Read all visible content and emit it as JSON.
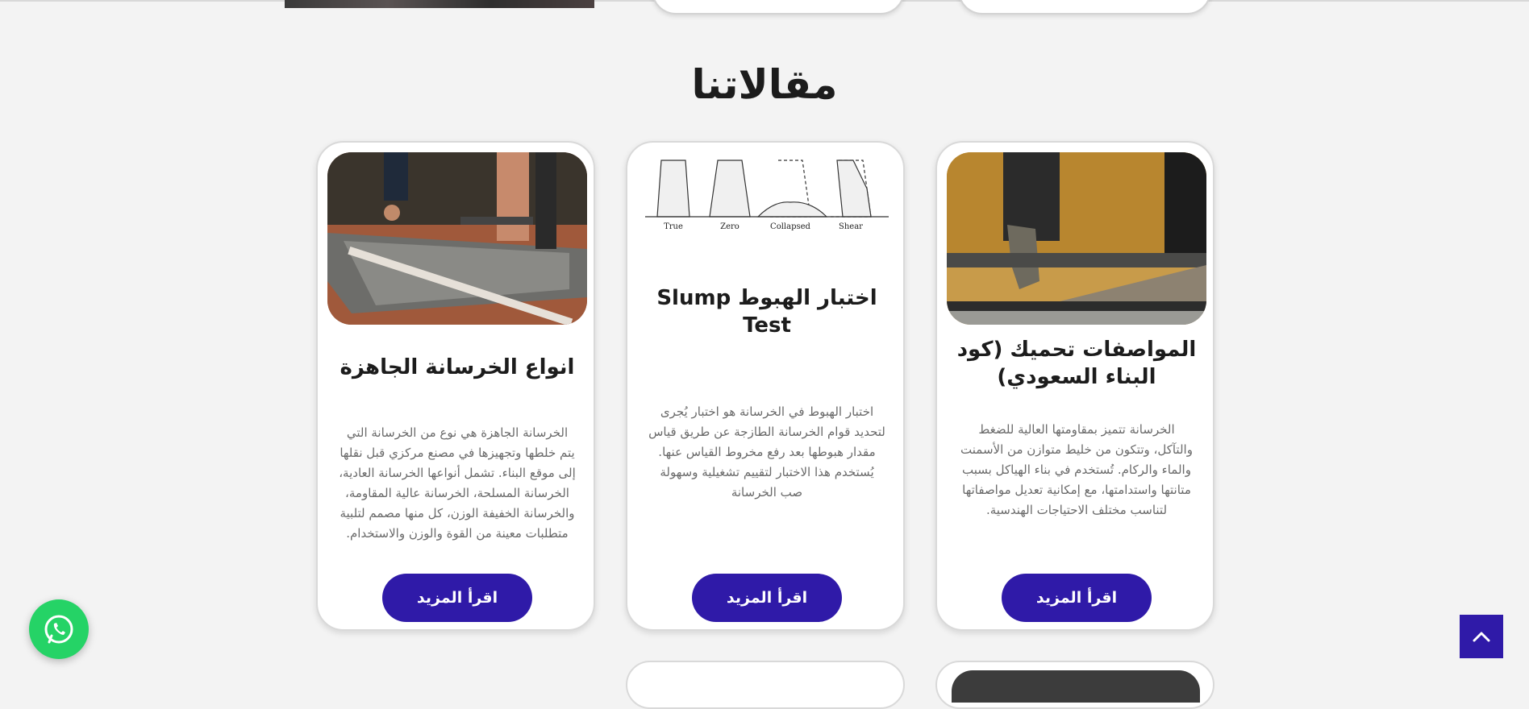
{
  "section": {
    "title": "مقالاتنا"
  },
  "articles": [
    {
      "title": "المواصفات تحميك (كود البناء السعودي)",
      "excerpt": "الخرسانة تتميز بمقاومتها العالية للضغط والتآكل، وتتكون من خليط متوازن من الأسمنت والماء والركام. تُستخدم في بناء الهياكل بسبب متانتها واستدامتها، مع إمكانية تعديل مواصفاتها لتناسب مختلف الاحتياجات الهندسية.",
      "button": "اقرأ المزيد",
      "image": "concrete-pouring-photo"
    },
    {
      "title": "اختبار الهبوط Slump Test",
      "excerpt": "اختبار الهبوط في الخرسانة هو اختبار يُجرى لتحديد قوام الخرسانة الطازجة عن طريق قياس مقدار هبوطها بعد رفع مخروط القياس عنها. يُستخدم هذا الاختبار لتقييم تشغيلية وسهولة صب الخرسانة",
      "button": "اقرأ المزيد",
      "image": "slump-test-diagram",
      "diagram_labels": [
        "True",
        "Zero",
        "Collapsed",
        "Shear"
      ]
    },
    {
      "title": "انواع الخرسانة الجاهزة",
      "excerpt": "الخرسانة الجاهزة هي نوع من الخرسانة التي يتم خلطها وتجهيزها في مصنع مركزي قبل نقلها إلى موقع البناء. تشمل أنواعها الخرسانة العادية، الخرسانة المسلحة، الخرسانة عالية المقاومة، والخرسانة الخفيفة الوزن، كل منها مصمم لتلبية متطلبات معينة من القوة والوزن والاستخدام.",
      "button": "اقرأ المزيد",
      "image": "concrete-leveling-photo"
    }
  ],
  "floating": {
    "whatsapp_icon": "whatsapp-icon",
    "scroll_top_icon": "chevron-up-icon"
  },
  "colors": {
    "accent": "#2f1aa8",
    "whatsapp": "#25d366",
    "background": "#f3f3f3"
  }
}
